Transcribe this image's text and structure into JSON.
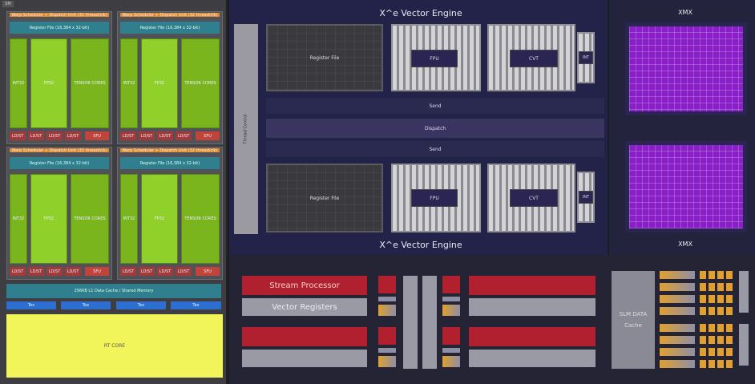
{
  "top_left_label": "SM",
  "left_panel": {
    "quad_header": "Warp Scheduler + Dispatch Unit (32 thread/clk)",
    "quad_register": "Register File (16,384 x 32-bit)",
    "columns": [
      "INT32",
      "FP32",
      "TENSOR CORES"
    ],
    "ldst_units": [
      "LD/ST",
      "LD/ST",
      "LD/ST",
      "LD/ST"
    ],
    "sfu": "SFU",
    "l1_cache_bar": "256KB L1 Data Cache / Shared Memory",
    "tex_units": [
      "Tex",
      "Tex",
      "Tex",
      "Tex"
    ],
    "rt_core": "RT CORE"
  },
  "vector_engine": {
    "top_title": "X^e Vector Engine",
    "bottom_title": "X^e Vector Engine",
    "register_file": "Register File",
    "fpu": "FPU",
    "em_int": "INT",
    "cvt": "CVT",
    "send": "Send",
    "dispatch": "Dispatch",
    "thread_control": "Thread Control"
  },
  "xmx": {
    "top_label": "XMX",
    "bottom_label": "XMX"
  },
  "bottom": {
    "stream_processor": "Stream Processor",
    "vector_registers": "Vector Registers",
    "slm_label": "SLM DATA Cache"
  },
  "colors": {
    "green": "#7ab51d",
    "orange": "#e08a2a",
    "purple": "#8a1fc9",
    "red": "#b0202f",
    "yellow": "#f1f55a",
    "blue": "#2c6fd0"
  }
}
